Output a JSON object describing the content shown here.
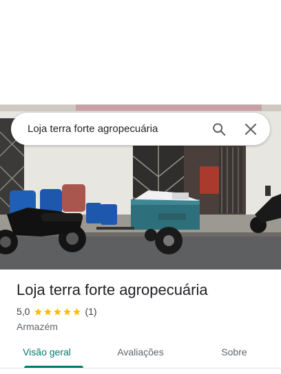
{
  "search": {
    "query": "Loja terra forte agropecuária",
    "search_icon": "search-icon",
    "close_icon": "close-icon"
  },
  "place": {
    "name": "Loja terra forte agropecuária",
    "rating": "5,0",
    "stars": 5,
    "review_count": "(1)",
    "category": "Armazém"
  },
  "tabs": [
    {
      "label": "Visão geral",
      "active": true
    },
    {
      "label": "Avaliações",
      "active": false
    },
    {
      "label": "Sobre",
      "active": false
    }
  ],
  "colors": {
    "accent": "#00796b",
    "star": "#fbbc04"
  }
}
